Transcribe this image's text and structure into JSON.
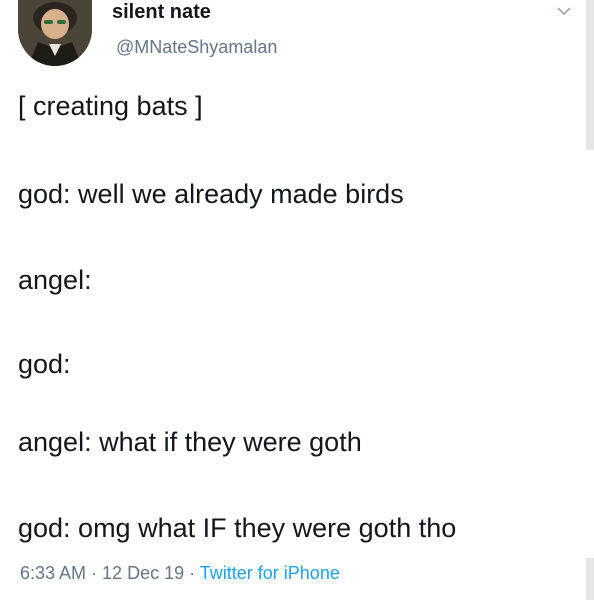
{
  "author": {
    "display_name": "silent nate",
    "handle": "@MNateShyamalan"
  },
  "tweet": {
    "lines": [
      "[ creating bats ]",
      "god: well we already made birds",
      "angel:",
      "god:",
      "angel: what if they were goth",
      "god: omg what IF they were goth tho"
    ]
  },
  "meta": {
    "time": "6:33 AM",
    "separator": " · ",
    "date": "12 Dec 19",
    "source": "Twitter for iPhone"
  },
  "icons": {
    "caret": "chevron-down-icon",
    "avatar": "avatar"
  },
  "colors": {
    "text": "#14171a",
    "secondary": "#657786",
    "link": "#1da1f2",
    "background": "#ffffff"
  }
}
